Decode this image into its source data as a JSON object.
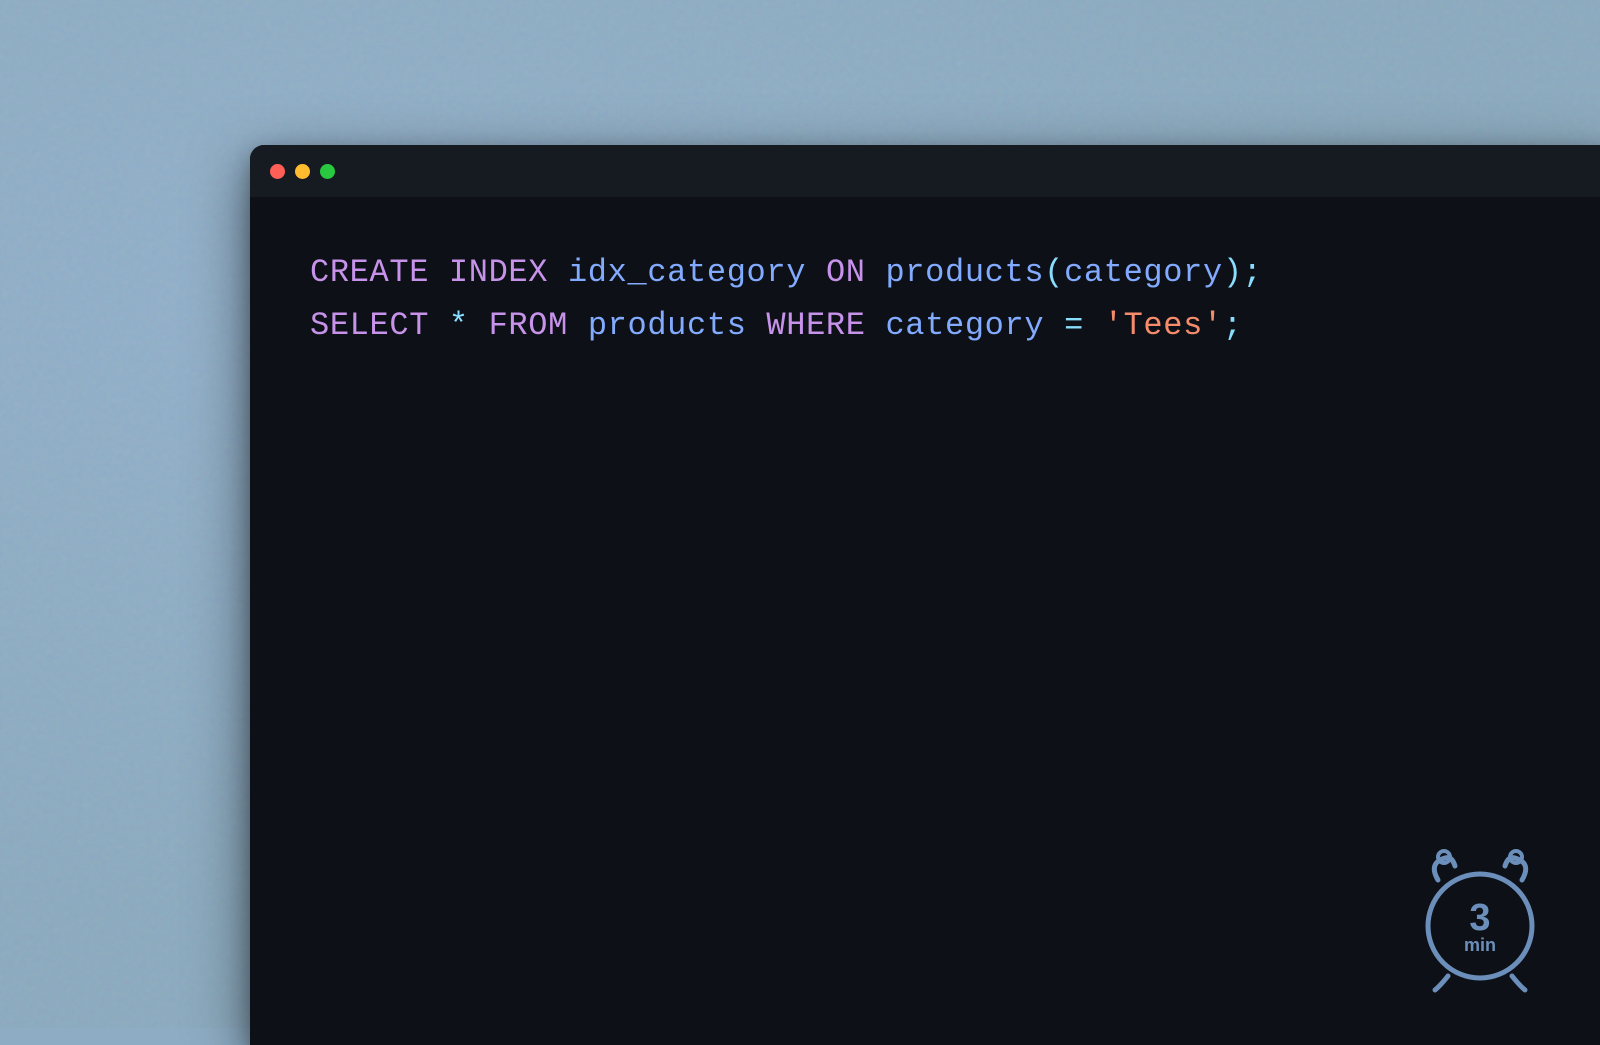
{
  "window": {
    "traffic_lights": {
      "close_color": "#ff5f57",
      "minimize_color": "#febc2e",
      "maximize_color": "#28c840"
    },
    "code": {
      "line1": {
        "keyword1": "CREATE",
        "keyword2": "INDEX",
        "identifier": "idx_category",
        "keyword3": "ON",
        "table": "products",
        "paren_open": "(",
        "column": "category",
        "paren_close": ")",
        "semicolon": ";"
      },
      "line2": {
        "keyword1": "SELECT",
        "star": "*",
        "keyword2": "FROM",
        "table": "products",
        "keyword3": "WHERE",
        "column": "category",
        "operator": "=",
        "string": "'Tees'",
        "semicolon": ";"
      }
    }
  },
  "clock": {
    "number": "3",
    "unit": "min"
  },
  "colors": {
    "background": "#7fa3bf",
    "window_bg": "#0d1117",
    "titlebar_bg": "#161b22",
    "keyword_color": "#c792ea",
    "identifier_color": "#82aaff",
    "operator_color": "#89ddff",
    "string_color": "#f78c6c"
  }
}
